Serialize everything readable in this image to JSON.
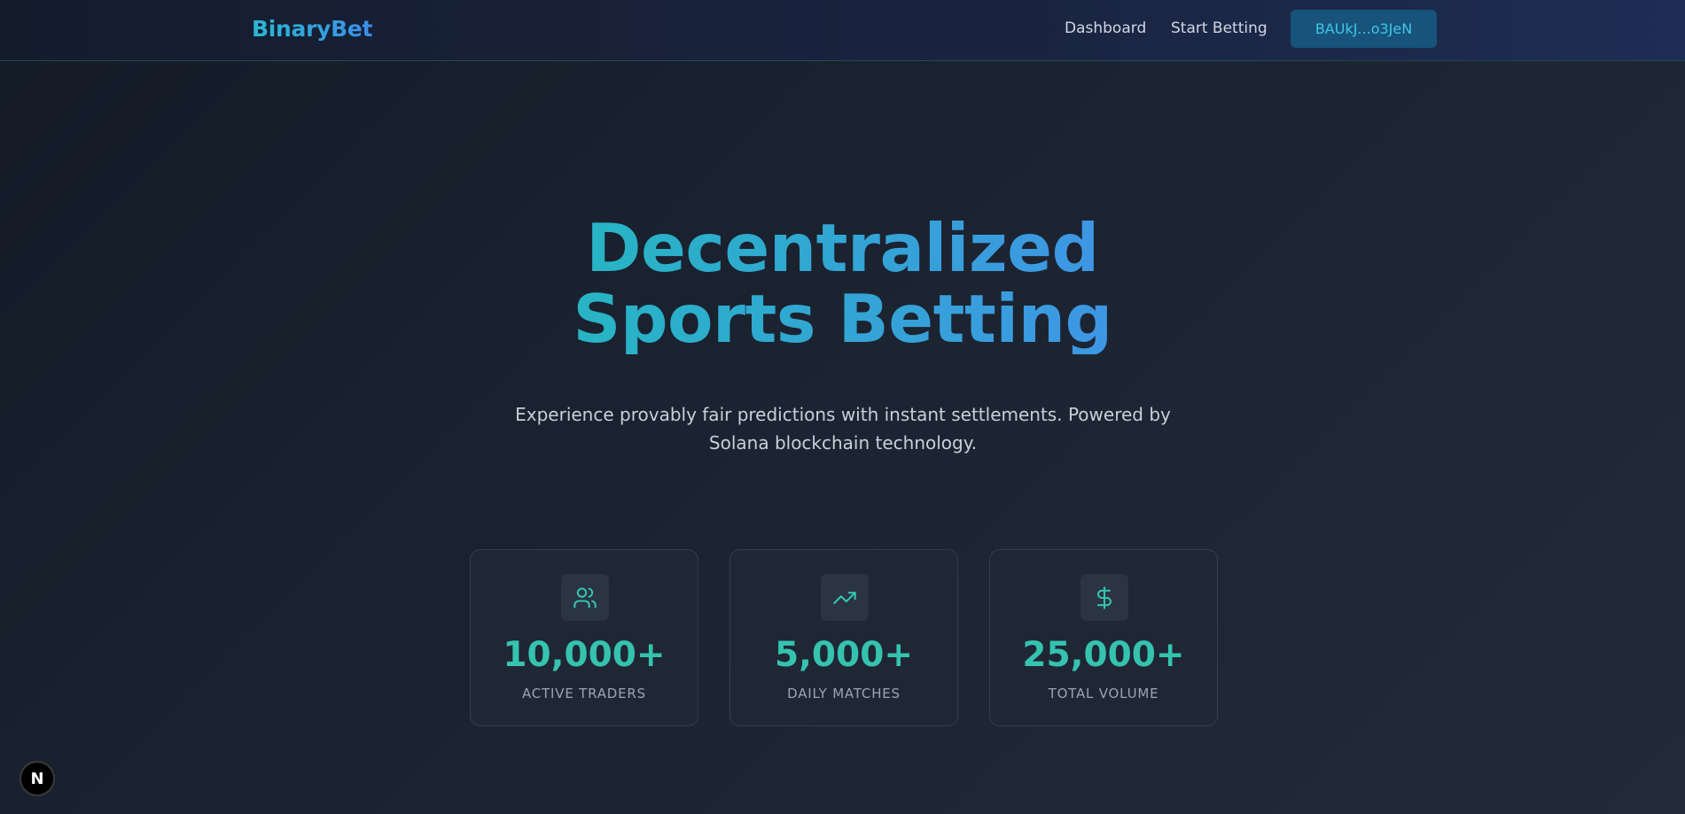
{
  "navbar": {
    "brand": "BinaryBet",
    "links": [
      "Dashboard",
      "Start Betting"
    ],
    "wallet_label": "BAUkJ...o3JeN"
  },
  "hero": {
    "title_line1": "Decentralized",
    "title_line2": "Sports Betting",
    "subtitle": "Experience provably fair predictions with instant settlements. Powered by Solana blockchain technology."
  },
  "stats": [
    {
      "icon": "users-icon",
      "value": "10,000+",
      "label": "ACTIVE TRADERS"
    },
    {
      "icon": "trending-up-icon",
      "value": "5,000+",
      "label": "DAILY MATCHES"
    },
    {
      "icon": "dollar-sign-icon",
      "value": "25,000+",
      "label": "TOTAL VOLUME"
    }
  ],
  "dev_badge": {
    "icon": "nextjs-icon",
    "label": "N"
  },
  "colors": {
    "accent": "#35c3b0",
    "brand_gradient_start": "#2ab8d3",
    "brand_gradient_end": "#3b8ee8",
    "wallet_bg": "#17537a"
  }
}
